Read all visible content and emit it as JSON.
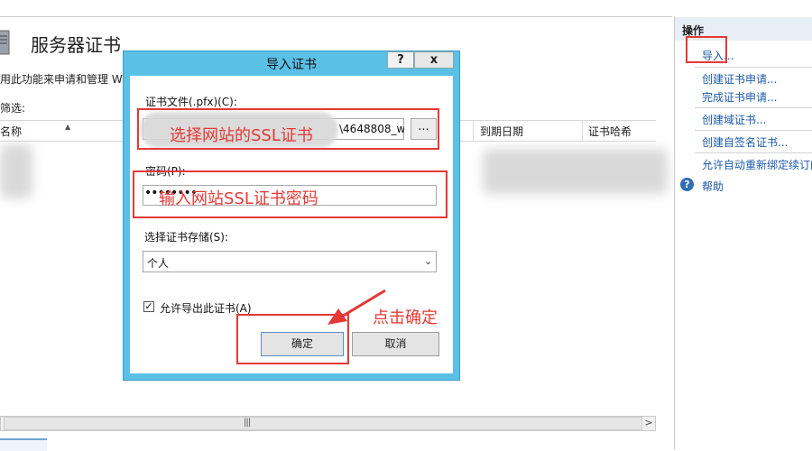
{
  "page": {
    "title": "服务器证书",
    "description": "用此功能来申请和管理 W",
    "filter_label": "筛选:"
  },
  "table": {
    "columns": [
      "名称",
      "到期日期",
      "证书哈希"
    ],
    "scroll_grip": "|||",
    "scroll_right": ">"
  },
  "actions": {
    "title": "操作",
    "items": [
      "导入...",
      "创建证书申请...",
      "完成证书申请...",
      "创建域证书...",
      "创建自签名证书...",
      "允许自动重新绑定续订的证书"
    ],
    "help": "帮助"
  },
  "dialog": {
    "title": "导入证书",
    "help_button": "?",
    "close_button": "x",
    "file_label": "证书文件(.pfx)(C):",
    "file_value": "\\4648808_w",
    "browse_button": "...",
    "password_label": "密码(P):",
    "password_value": "••••••••",
    "store_label": "选择证书存储(S):",
    "store_value": "个人",
    "store_chevron": "⌄",
    "export_checked": true,
    "export_label": "允许导出此证书(A)",
    "ok_button": "确定",
    "cancel_button": "取消"
  },
  "annotations": {
    "file_note": "选择网站的SSL证书",
    "password_note": "输入网站SSL证书密码",
    "ok_note": "点击确定",
    "color": "#e53935"
  },
  "colors": {
    "dialog_frame": "#5bc0e6",
    "link": "#1e5aa8",
    "annotation_red": "#e53935"
  }
}
